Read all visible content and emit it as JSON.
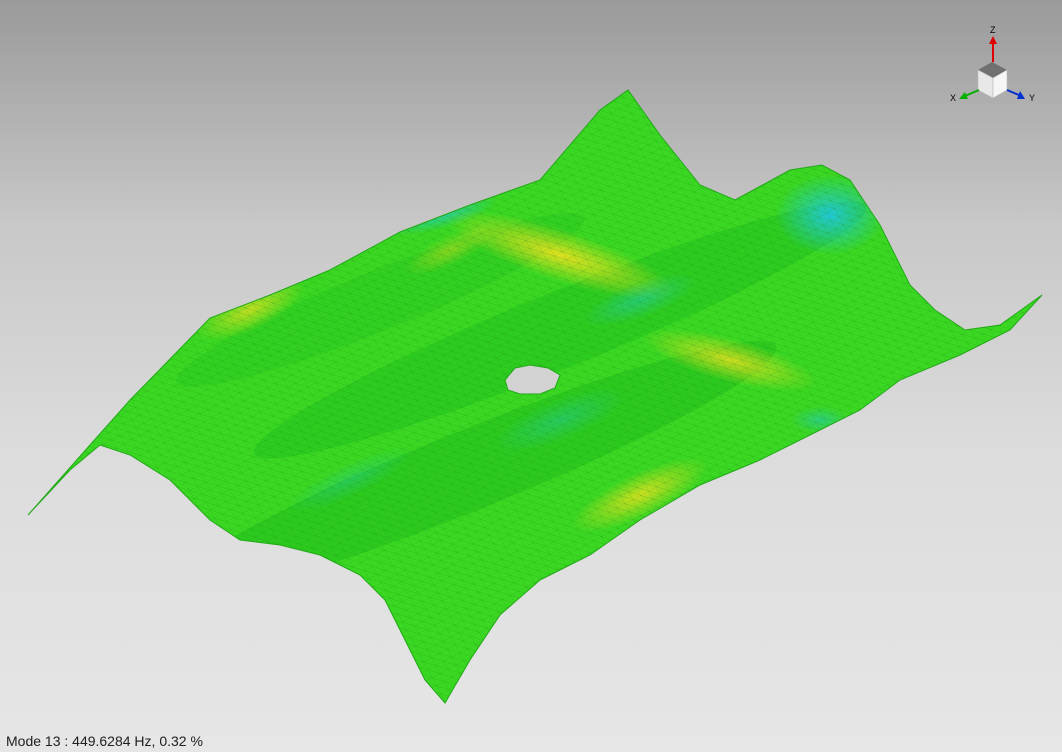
{
  "view": {
    "status_text": "Mode 13 : 449.6284 Hz, 0.32 %"
  },
  "triad": {
    "z_label": "Z",
    "x_label": "X",
    "y_label": "Y",
    "z_color": "#e00000",
    "x_color": "#00b000",
    "y_color": "#0030d0"
  },
  "contour_colors": {
    "low": "#1ec8e6",
    "mid": "#3cdc1e",
    "high": "#dcdc1e"
  },
  "icons": [
    "view-cube-icon",
    "z-axis-arrow-icon",
    "x-axis-arrow-icon",
    "y-axis-arrow-icon"
  ]
}
